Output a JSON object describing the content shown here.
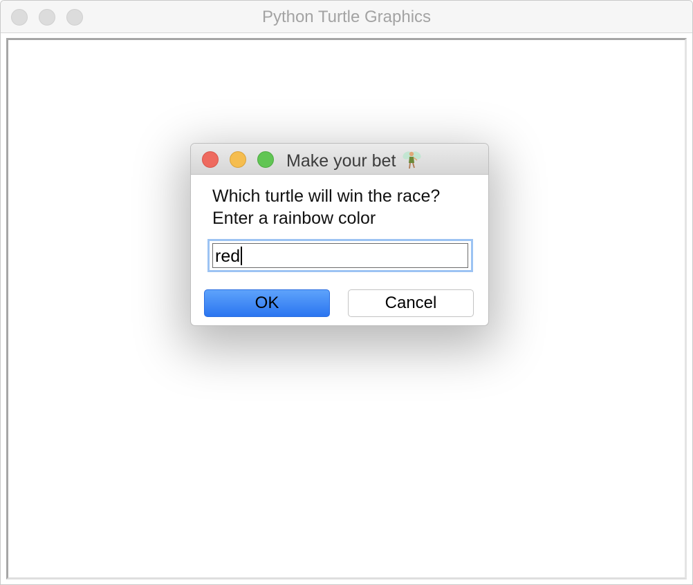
{
  "window": {
    "title": "Python Turtle Graphics"
  },
  "dialog": {
    "title": "Make your bet",
    "title_icon": "fairy-icon",
    "prompt_line1": "Which turtle will win the race?",
    "prompt_line2": "Enter a rainbow color",
    "input_value": "red",
    "ok_label": "OK",
    "cancel_label": "Cancel"
  },
  "colors": {
    "close": "#ee6a5f",
    "minimize": "#f5bd4f",
    "maximize": "#61c554",
    "ok_button": "#2b75f0",
    "focus_ring": "#9cc3f3"
  }
}
